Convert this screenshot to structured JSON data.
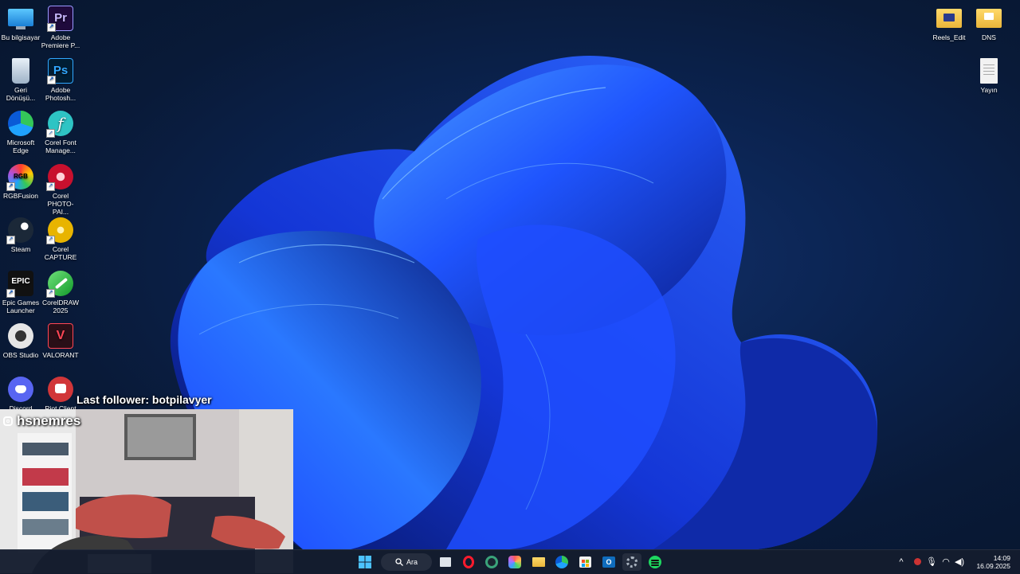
{
  "desktop_icons_left": [
    {
      "label": "Bu bilgisayar",
      "icon": "monitor-icon"
    },
    {
      "label": "Adobe Premiere P...",
      "icon": "premiere-icon",
      "abbr": "Pr"
    },
    {
      "label": "Geri Dönüşü...",
      "icon": "recycle-bin-icon"
    },
    {
      "label": "Adobe Photosh...",
      "icon": "photoshop-icon",
      "abbr": "Ps"
    },
    {
      "label": "Microsoft Edge",
      "icon": "edge-icon"
    },
    {
      "label": "Corel Font Manage...",
      "icon": "corel-font-icon"
    },
    {
      "label": "RGBFusion",
      "icon": "rgbfusion-icon",
      "abbr": "RGB"
    },
    {
      "label": "Corel PHOTO-PAI...",
      "icon": "corel-photopaint-icon"
    },
    {
      "label": "Steam",
      "icon": "steam-icon"
    },
    {
      "label": "Corel CAPTURE",
      "icon": "corel-capture-icon"
    },
    {
      "label": "Epic Games Launcher",
      "icon": "epic-games-icon",
      "abbr": "EPIC"
    },
    {
      "label": "CorelDRAW 2025",
      "icon": "coreldraw-icon"
    },
    {
      "label": "OBS Studio",
      "icon": "obs-icon"
    },
    {
      "label": "VALORANT",
      "icon": "valorant-icon"
    },
    {
      "label": "Discord",
      "icon": "discord-icon"
    },
    {
      "label": "Riot Client",
      "icon": "riot-icon"
    }
  ],
  "desktop_icons_right": [
    {
      "label": "Reels_Edit",
      "icon": "folder-icon"
    },
    {
      "label": "DNS",
      "icon": "folder-icon"
    },
    {
      "label": "Yayın",
      "icon": "text-file-icon"
    }
  ],
  "overlay": {
    "last_follower": "Last follower: botpilavyer",
    "instagram_handle": "hsnemres"
  },
  "taskbar": {
    "search_label": "Ara",
    "apps": [
      "start-icon",
      "search-icon",
      "task-view-icon",
      "opera-icon",
      "app-circle-icon",
      "m365-icon",
      "file-explorer-icon",
      "edge-icon",
      "store-icon",
      "outlook-icon",
      "settings-icon",
      "spotify-icon"
    ],
    "time": "14:09",
    "date": "16.09.2025"
  },
  "colors": {
    "accent": "#1f5fff",
    "taskbar": "#141c2e"
  }
}
